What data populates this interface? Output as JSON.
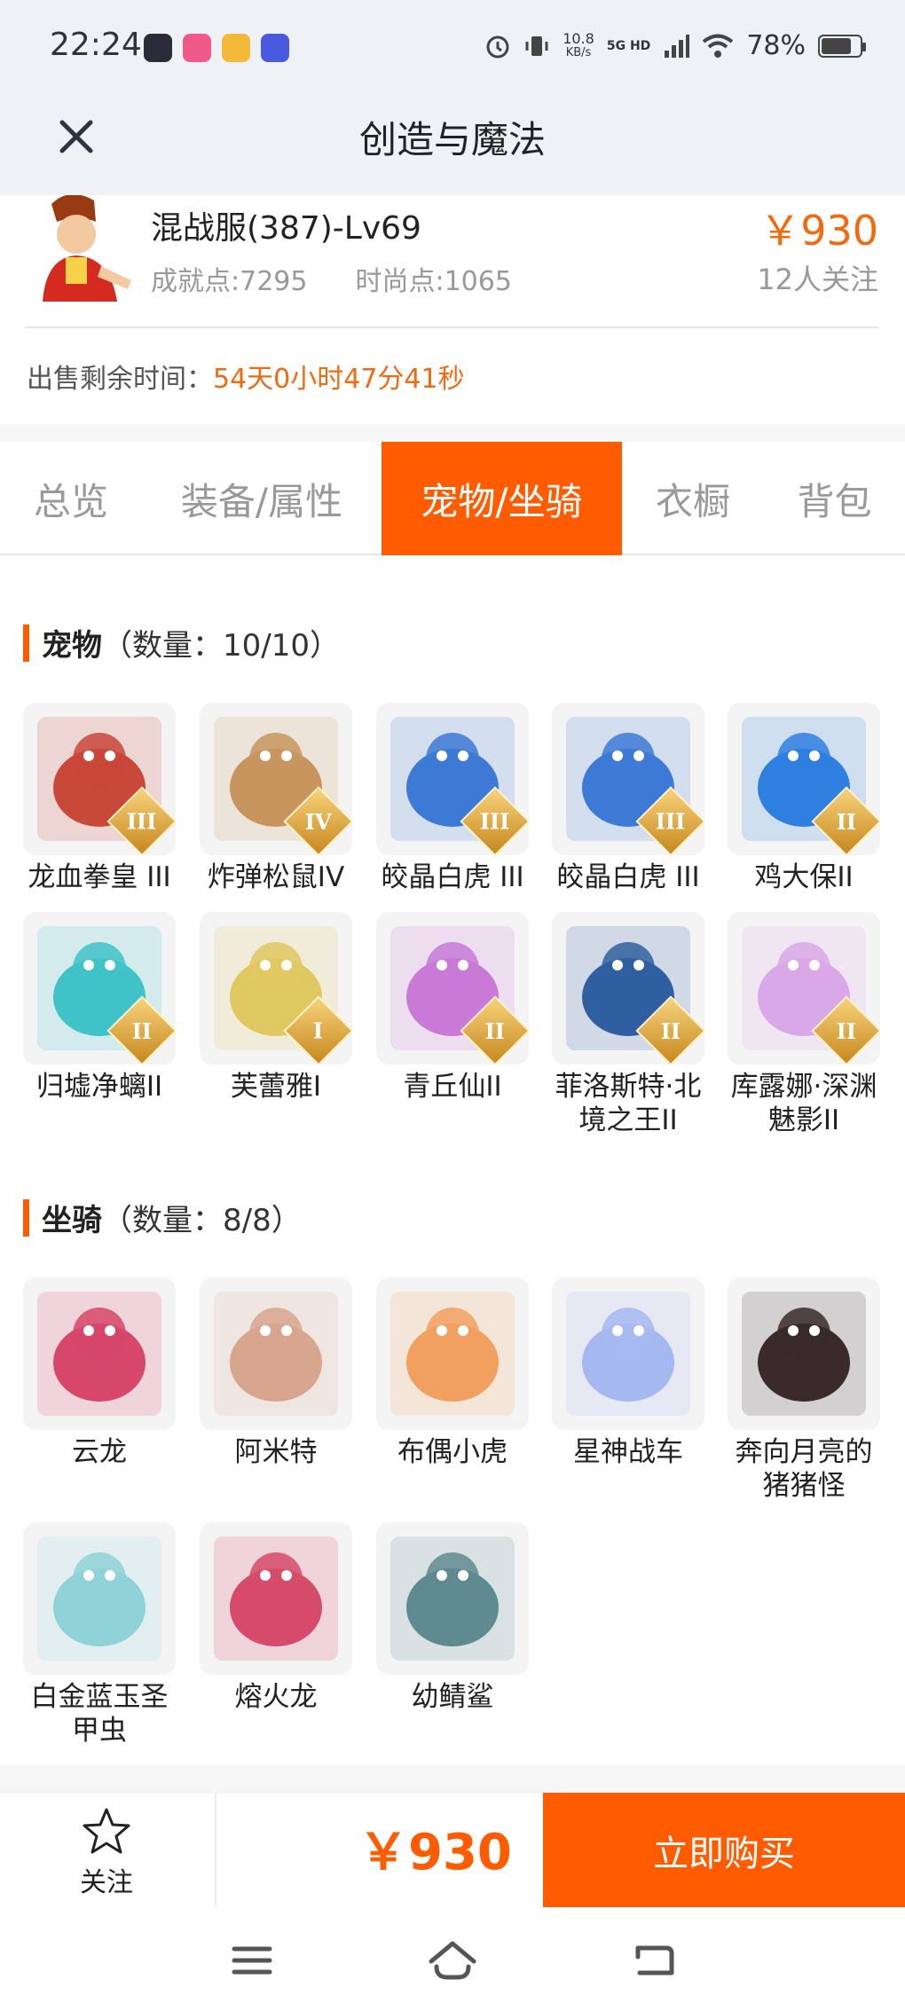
{
  "status_bar": {
    "time": "22:24",
    "speed_value": "10.8",
    "speed_unit": "KB/s",
    "network": "5G HD",
    "battery": "78%",
    "battery_level": 0.78
  },
  "header": {
    "title": "创造与魔法"
  },
  "product": {
    "server": "混战服(387)-Lv69",
    "achievement": "成就点:7295",
    "fashion": "时尚点:1065",
    "price": "￥930",
    "followers": "12人关注",
    "sale_time_label": "出售剩余时间：",
    "sale_time_value": "54天0小时47分41秒"
  },
  "tabs": [
    {
      "label": "总览",
      "active": false
    },
    {
      "label": "装备/属性",
      "active": false
    },
    {
      "label": "宠物/坐骑",
      "active": true
    },
    {
      "label": "衣橱",
      "active": false
    },
    {
      "label": "背包",
      "active": false
    }
  ],
  "pets": {
    "title": "宠物",
    "count": "（数量：10/10）",
    "items": [
      {
        "name": "龙血拳皇 III",
        "badge": "III",
        "icon": "red-beast-icon",
        "color": "#c8483a"
      },
      {
        "name": "炸弹松鼠IV",
        "badge": "IV",
        "icon": "squirrel-icon",
        "color": "#c9955e"
      },
      {
        "name": "皎晶白虎 III",
        "badge": "III",
        "icon": "white-tiger-icon",
        "color": "#3d7ad6"
      },
      {
        "name": "皎晶白虎 III",
        "badge": "III",
        "icon": "white-tiger-icon",
        "color": "#3d7ad6"
      },
      {
        "name": "鸡大保II",
        "badge": "II",
        "icon": "blue-bird-icon",
        "color": "#2f7fe0"
      },
      {
        "name": "归墟净螭II",
        "badge": "II",
        "icon": "cyan-dragon-icon",
        "color": "#3fc3c8"
      },
      {
        "name": "芙蕾雅I",
        "badge": "I",
        "icon": "valkyrie-icon",
        "color": "#e0c860"
      },
      {
        "name": "青丘仙II",
        "badge": "II",
        "icon": "fox-fairy-icon",
        "color": "#c87ad6"
      },
      {
        "name": "菲洛斯特·北境之王II",
        "badge": "II",
        "icon": "ice-king-icon",
        "color": "#2f5fa0"
      },
      {
        "name": "库露娜·深渊魅影II",
        "badge": "II",
        "icon": "abyss-maiden-icon",
        "color": "#d9a8e8"
      }
    ]
  },
  "mounts": {
    "title": "坐骑",
    "count": "（数量：8/8）",
    "items": [
      {
        "name": "云龙",
        "icon": "cloud-dragon-icon",
        "color": "#d6476a"
      },
      {
        "name": "阿米特",
        "icon": "crocodile-icon",
        "color": "#d8a58f"
      },
      {
        "name": "布偶小虎",
        "icon": "toy-tiger-icon",
        "color": "#f2a060"
      },
      {
        "name": "星神战车",
        "icon": "star-chariot-icon",
        "color": "#a6b8f0"
      },
      {
        "name": "奔向月亮的猪猪怪",
        "icon": "pig-icon",
        "color": "#3a2a2a"
      },
      {
        "name": "白金蓝玉圣甲虫",
        "icon": "scarab-icon",
        "color": "#8fd2d8"
      },
      {
        "name": "熔火龙",
        "icon": "magma-dragon-icon",
        "color": "#d64a6a"
      },
      {
        "name": "幼鲭鲨",
        "icon": "shark-icon",
        "color": "#5f8a8f"
      }
    ]
  },
  "bottom": {
    "follow_label": "关注",
    "price": "￥930",
    "buy_label": "立即购买"
  },
  "colors": {
    "accent": "#ff5b00",
    "price": "#f26a10",
    "header_bg": "#eef2f7"
  }
}
